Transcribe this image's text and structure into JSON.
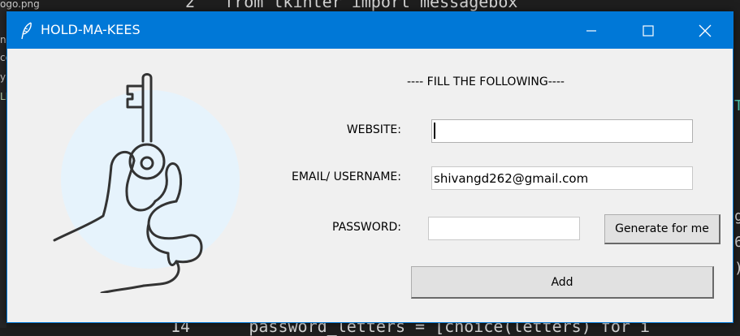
{
  "background": {
    "sidebar_items": [
      "ogo.png",
      "n",
      "co",
      "y",
      "LE"
    ],
    "code_top": "2   from tkinter import messagebox",
    "code_bottom": "14      password_letters = [choice(letters) for i",
    "right_chars": [
      "T",
      "g",
      "6",
      ")"
    ]
  },
  "window": {
    "title": "HOLD-MA-KEES",
    "controls": {
      "minimize": "minimize-icon",
      "maximize": "maximize-icon",
      "close": "close-icon"
    }
  },
  "form": {
    "heading": "---- FILL THE FOLLOWING----",
    "website_label": "WEBSITE:",
    "website_value": "",
    "email_label": "EMAIL/ USERNAME:",
    "email_value": "shivangd262@gmail.com",
    "password_label": "PASSWORD:",
    "password_value": "",
    "generate_label": "Generate for me",
    "add_label": "Add"
  },
  "colors": {
    "titlebar": "#0078d7",
    "window_bg": "#f0f0f0",
    "logo_circle": "#e6f3fc",
    "logo_stroke": "#333333"
  }
}
